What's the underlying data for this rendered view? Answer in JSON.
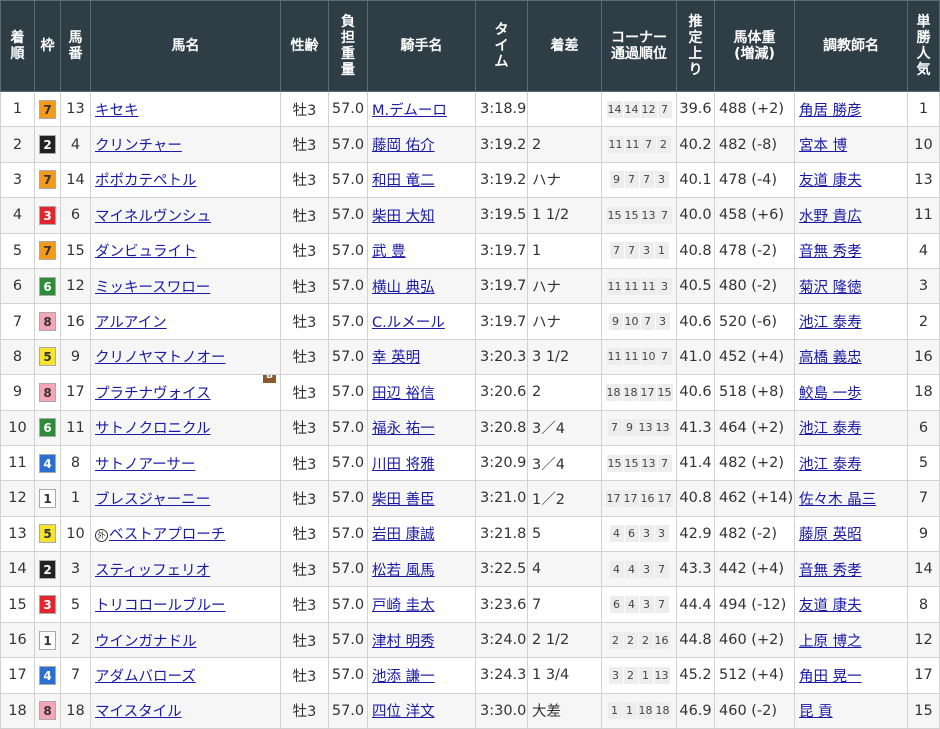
{
  "headers": [
    "着順",
    "枠",
    "馬番",
    "馬名",
    "性齢",
    "負担重量",
    "騎手名",
    "タイム",
    "着差",
    "コーナー通過順位",
    "推定上り",
    "馬体重(増減)",
    "調教師名",
    "単勝人気"
  ],
  "waku_colors": {
    "1": {
      "bg": "#ffffff",
      "fg": "#333333"
    },
    "2": {
      "bg": "#222222",
      "fg": "#ffffff"
    },
    "3": {
      "bg": "#e0262e",
      "fg": "#ffffff"
    },
    "4": {
      "bg": "#2c6fd1",
      "fg": "#ffffff"
    },
    "5": {
      "bg": "#f6e330",
      "fg": "#333333"
    },
    "6": {
      "bg": "#2e8b3a",
      "fg": "#ffffff"
    },
    "7": {
      "bg": "#f39a1c",
      "fg": "#333333"
    },
    "8": {
      "bg": "#f4a6b8",
      "fg": "#333333"
    }
  },
  "rows": [
    {
      "rank": "1",
      "waku": "7",
      "num": "13",
      "horse": "キセキ",
      "sexage": "牡3",
      "weight": "57.0",
      "jockey": "M.デムーロ",
      "time": "3:18.9",
      "margin": "",
      "corner": [
        "14",
        "14",
        "12",
        "7"
      ],
      "last": "39.6",
      "bw": "488 (+2)",
      "trainer": "角居 勝彦",
      "pop": "1"
    },
    {
      "rank": "2",
      "waku": "2",
      "num": "4",
      "horse": "クリンチャー",
      "sexage": "牡3",
      "weight": "57.0",
      "jockey": "藤岡 佑介",
      "time": "3:19.2",
      "margin": "2",
      "corner": [
        "11",
        "11",
        "7",
        "2"
      ],
      "last": "40.2",
      "bw": "482 (-8)",
      "trainer": "宮本 博",
      "pop": "10"
    },
    {
      "rank": "3",
      "waku": "7",
      "num": "14",
      "horse": "ポポカテペトル",
      "sexage": "牡3",
      "weight": "57.0",
      "jockey": "和田 竜二",
      "time": "3:19.2",
      "margin": "ハナ",
      "corner": [
        "9",
        "7",
        "7",
        "3"
      ],
      "last": "40.1",
      "bw": "478 (-4)",
      "trainer": "友道 康夫",
      "pop": "13"
    },
    {
      "rank": "4",
      "waku": "3",
      "num": "6",
      "horse": "マイネルヴンシュ",
      "sexage": "牡3",
      "weight": "57.0",
      "jockey": "柴田 大知",
      "time": "3:19.5",
      "margin": "1 1/2",
      "corner": [
        "15",
        "15",
        "13",
        "7"
      ],
      "last": "40.0",
      "bw": "458 (+6)",
      "trainer": "水野 貴広",
      "pop": "11"
    },
    {
      "rank": "5",
      "waku": "7",
      "num": "15",
      "horse": "ダンビュライト",
      "sexage": "牡3",
      "weight": "57.0",
      "jockey": "武 豊",
      "time": "3:19.7",
      "margin": "1",
      "corner": [
        "7",
        "7",
        "3",
        "1"
      ],
      "last": "40.8",
      "bw": "478 (-2)",
      "trainer": "音無 秀孝",
      "pop": "4"
    },
    {
      "rank": "6",
      "waku": "6",
      "num": "12",
      "horse": "ミッキースワロー",
      "sexage": "牡3",
      "weight": "57.0",
      "jockey": "横山 典弘",
      "time": "3:19.7",
      "margin": "ハナ",
      "corner": [
        "11",
        "11",
        "11",
        "3"
      ],
      "last": "40.5",
      "bw": "480 (-2)",
      "trainer": "菊沢 隆徳",
      "pop": "3"
    },
    {
      "rank": "7",
      "waku": "8",
      "num": "16",
      "horse": "アルアイン",
      "sexage": "牡3",
      "weight": "57.0",
      "jockey": "C.ルメール",
      "time": "3:19.7",
      "margin": "ハナ",
      "corner": [
        "9",
        "10",
        "7",
        "3"
      ],
      "last": "40.6",
      "bw": "520 (-6)",
      "trainer": "池江 泰寿",
      "pop": "2"
    },
    {
      "rank": "8",
      "waku": "5",
      "num": "9",
      "horse": "クリノヤマトノオー",
      "sexage": "牡3",
      "weight": "57.0",
      "jockey": "幸 英明",
      "time": "3:20.3",
      "margin": "3 1/2",
      "corner": [
        "11",
        "11",
        "10",
        "7"
      ],
      "last": "41.0",
      "bw": "452 (+4)",
      "trainer": "高橋 義忠",
      "pop": "16"
    },
    {
      "rank": "9",
      "waku": "8",
      "num": "17",
      "horse": "プラチナヴォイス",
      "blinker": "B",
      "sexage": "牡3",
      "weight": "57.0",
      "jockey": "田辺 裕信",
      "time": "3:20.6",
      "margin": "2",
      "corner": [
        "18",
        "18",
        "17",
        "15"
      ],
      "last": "40.6",
      "bw": "518 (+8)",
      "trainer": "鮫島 一歩",
      "pop": "18"
    },
    {
      "rank": "10",
      "waku": "6",
      "num": "11",
      "horse": "サトノクロニクル",
      "sexage": "牡3",
      "weight": "57.0",
      "jockey": "福永 祐一",
      "time": "3:20.8",
      "margin": "3／4",
      "corner": [
        "7",
        "9",
        "13",
        "13"
      ],
      "last": "41.3",
      "bw": "464 (+2)",
      "trainer": "池江 泰寿",
      "pop": "6"
    },
    {
      "rank": "11",
      "waku": "4",
      "num": "8",
      "horse": "サトノアーサー",
      "sexage": "牡3",
      "weight": "57.0",
      "jockey": "川田 将雅",
      "time": "3:20.9",
      "margin": "3／4",
      "corner": [
        "15",
        "15",
        "13",
        "7"
      ],
      "last": "41.4",
      "bw": "482 (+2)",
      "trainer": "池江 泰寿",
      "pop": "5"
    },
    {
      "rank": "12",
      "waku": "1",
      "num": "1",
      "horse": "ブレスジャーニー",
      "sexage": "牡3",
      "weight": "57.0",
      "jockey": "柴田 善臣",
      "time": "3:21.0",
      "margin": "1／2",
      "corner": [
        "17",
        "17",
        "16",
        "17"
      ],
      "last": "40.8",
      "bw": "462 (+14)",
      "trainer": "佐々木 晶三",
      "pop": "7"
    },
    {
      "rank": "13",
      "waku": "5",
      "num": "10",
      "horse": "ベストアプローチ",
      "mark": "外",
      "sexage": "牡3",
      "weight": "57.0",
      "jockey": "岩田 康誠",
      "time": "3:21.8",
      "margin": "5",
      "corner": [
        "4",
        "6",
        "3",
        "3"
      ],
      "last": "42.9",
      "bw": "482 (-2)",
      "trainer": "藤原 英昭",
      "pop": "9"
    },
    {
      "rank": "14",
      "waku": "2",
      "num": "3",
      "horse": "スティッフェリオ",
      "sexage": "牡3",
      "weight": "57.0",
      "jockey": "松若 風馬",
      "time": "3:22.5",
      "margin": "4",
      "corner": [
        "4",
        "4",
        "3",
        "7"
      ],
      "last": "43.3",
      "bw": "442 (+4)",
      "trainer": "音無 秀孝",
      "pop": "14"
    },
    {
      "rank": "15",
      "waku": "3",
      "num": "5",
      "horse": "トリコロールブルー",
      "sexage": "牡3",
      "weight": "57.0",
      "jockey": "戸崎 圭太",
      "time": "3:23.6",
      "margin": "7",
      "corner": [
        "6",
        "4",
        "3",
        "7"
      ],
      "last": "44.4",
      "bw": "494 (-12)",
      "trainer": "友道 康夫",
      "pop": "8"
    },
    {
      "rank": "16",
      "waku": "1",
      "num": "2",
      "horse": "ウインガナドル",
      "sexage": "牡3",
      "weight": "57.0",
      "jockey": "津村 明秀",
      "time": "3:24.0",
      "margin": "2 1/2",
      "corner": [
        "2",
        "2",
        "2",
        "16"
      ],
      "last": "44.8",
      "bw": "460 (+2)",
      "trainer": "上原 博之",
      "pop": "12"
    },
    {
      "rank": "17",
      "waku": "4",
      "num": "7",
      "horse": "アダムバローズ",
      "sexage": "牡3",
      "weight": "57.0",
      "jockey": "池添 謙一",
      "time": "3:24.3",
      "margin": "1 3/4",
      "corner": [
        "3",
        "2",
        "1",
        "13"
      ],
      "last": "45.2",
      "bw": "512 (+4)",
      "trainer": "角田 晃一",
      "pop": "17"
    },
    {
      "rank": "18",
      "waku": "8",
      "num": "18",
      "horse": "マイスタイル",
      "sexage": "牡3",
      "weight": "57.0",
      "jockey": "四位 洋文",
      "time": "3:30.0",
      "margin": "大差",
      "corner": [
        "1",
        "1",
        "18",
        "18"
      ],
      "last": "46.9",
      "bw": "460 (-2)",
      "trainer": "昆 貢",
      "pop": "15"
    }
  ]
}
